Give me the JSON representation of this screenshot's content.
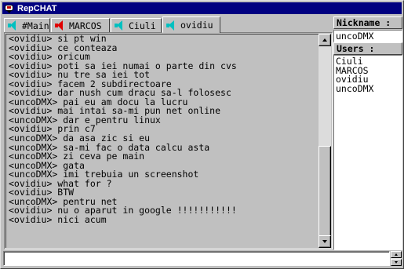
{
  "window": {
    "title": "RepCHAT"
  },
  "tabs": [
    {
      "label": "#Main",
      "icon": "speaker-icon",
      "color": "#00c0c0"
    },
    {
      "label": "MARCOS",
      "icon": "speaker-icon",
      "color": "#e00000"
    },
    {
      "label": "Ciuli",
      "icon": "speaker-icon",
      "color": "#00c0c0"
    },
    {
      "label": "ovidiu",
      "icon": "speaker-icon",
      "color": "#00c0c0",
      "active": true
    }
  ],
  "chat": {
    "lines": [
      "<ovidiu> si pt win",
      "<ovidiu> ce conteaza",
      "<ovidiu> oricum",
      "<ovidiu> poti sa iei numai o parte din cvs",
      "<ovidiu> nu tre sa iei tot",
      "<ovidiu> facem 2 subdirectoare",
      "<ovidiu> dar nush cum dracu sa-l folosesc",
      "<uncoDMX> pai eu am docu la lucru",
      "<ovidiu> mai intai sa-mi pun net online",
      "<uncoDMX> dar e pentru linux",
      "<ovidiu> prin c7",
      "<uncoDMX> da asa zic si eu",
      "<uncoDMX> sa-mi fac o data calcu asta",
      "<uncoDMX> zi ceva pe main",
      "<uncoDMX> gata",
      "<uncoDMX> imi trebuia un screenshot",
      "<ovidiu> what for ?",
      "<ovidiu> BTW",
      "<uncoDMX> pentru net",
      "<ovidiu> nu o aparut in google !!!!!!!!!!!",
      "<ovidiu> nici acum"
    ]
  },
  "nickname": {
    "label": "Nickname :",
    "value": "uncoDMX"
  },
  "users": {
    "label": "Users :",
    "items": [
      "Ciuli",
      "MARCOS",
      "ovidiu",
      "uncoDMX"
    ]
  },
  "message_input": {
    "value": ""
  }
}
